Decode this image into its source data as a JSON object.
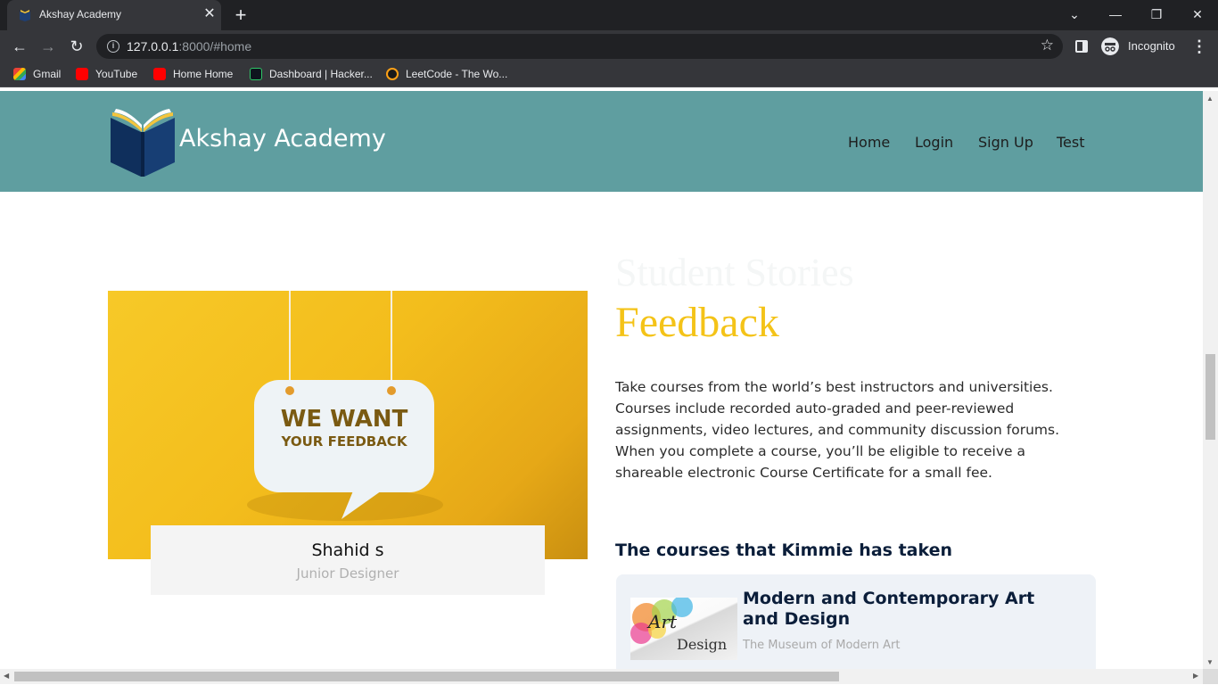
{
  "browser": {
    "tab_title": "Akshay Academy",
    "url_host": "127.0.0.1",
    "url_rest": ":8000/#home",
    "profile_label": "Incognito",
    "bookmarks": [
      {
        "label": "Gmail",
        "icon": "gmail-icon"
      },
      {
        "label": "YouTube",
        "icon": "youtube-icon"
      },
      {
        "label": "Home Home",
        "icon": "youtube-icon"
      },
      {
        "label": "Dashboard | Hacker...",
        "icon": "hackerrank-icon"
      },
      {
        "label": "LeetCode - The Wo...",
        "icon": "leetcode-icon"
      }
    ]
  },
  "site": {
    "brand": "Akshay Academy",
    "nav": [
      "Home",
      "Login",
      "Sign Up",
      "Test"
    ],
    "header_color": "#5f9ea0"
  },
  "feedback": {
    "image_line1": "WE WANT",
    "image_line2": "YOUR FEEDBACK",
    "person_name": "Shahid s",
    "person_role": "Junior Designer"
  },
  "main": {
    "faint_heading": "Student Stories",
    "heading": "Feedback",
    "heading_color": "#f4c318",
    "description": "Take courses from the world’s best instructors and universities. Courses include recorded auto-graded and peer-reviewed assignments, video lectures, and community discussion forums. When you complete a course, you’ll be eligible to receive a shareable electronic Course Certificate for a small fee.",
    "courses_title": "The courses that Kimmie has taken",
    "course": {
      "name": "Modern and Contemporary Art and Design",
      "org": "The Museum of Modern Art",
      "thumb_text1": "Art",
      "thumb_text2": "Design"
    }
  }
}
